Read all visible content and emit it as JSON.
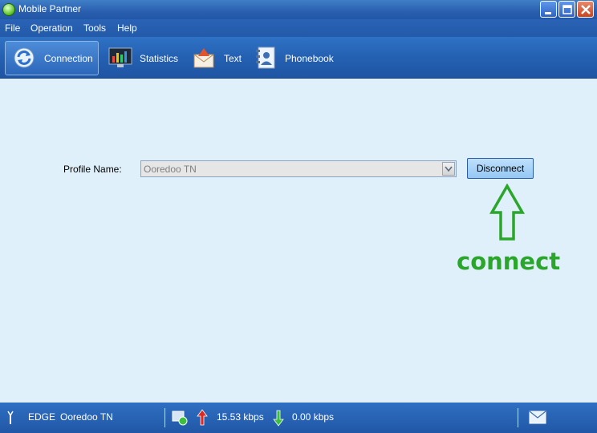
{
  "window": {
    "title": "Mobile Partner"
  },
  "menu": {
    "items": [
      "File",
      "Operation",
      "Tools",
      "Help"
    ]
  },
  "toolbar": {
    "connection_label": "Connection",
    "statistics_label": "Statistics",
    "text_label": "Text",
    "phonebook_label": "Phonebook"
  },
  "profile": {
    "label": "Profile Name:",
    "value": "Ooredoo TN"
  },
  "action": {
    "disconnect_label": "Disconnect"
  },
  "annotation": {
    "text": "connect",
    "color": "#2aa62a"
  },
  "status": {
    "network_type": "EDGE",
    "operator": "Ooredoo TN",
    "upload_speed": "15.53 kbps",
    "download_speed": "0.00 kbps"
  },
  "colors": {
    "accent": "#2460b2",
    "content_bg": "#dff0fb"
  }
}
